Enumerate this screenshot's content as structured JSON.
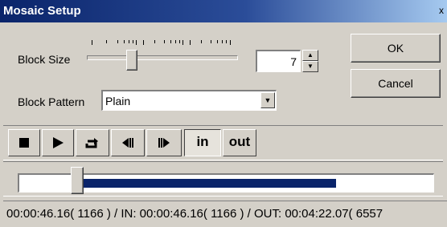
{
  "window": {
    "title": "Mosaic Setup",
    "close_glyph": "x"
  },
  "block_size": {
    "label": "Block Size",
    "value": "7",
    "slider_fraction": 0.28
  },
  "block_pattern": {
    "label": "Block Pattern",
    "selected": "Plain"
  },
  "buttons": {
    "ok": "OK",
    "cancel": "Cancel"
  },
  "toolbar": {
    "stop_icon": "stop-icon",
    "play_icon": "play-icon",
    "loop_icon": "loop-icon",
    "prev_frame_icon": "step-back-icon",
    "next_frame_icon": "step-forward-icon",
    "in_label": "in",
    "out_label": "out"
  },
  "seek": {
    "position_fraction": 0.14,
    "range_end_fraction": 0.76
  },
  "status": {
    "text": "00:00:46.16( 1166 ) / IN: 00:00:46.16( 1166 ) / OUT: 00:04:22.07( 6557"
  }
}
